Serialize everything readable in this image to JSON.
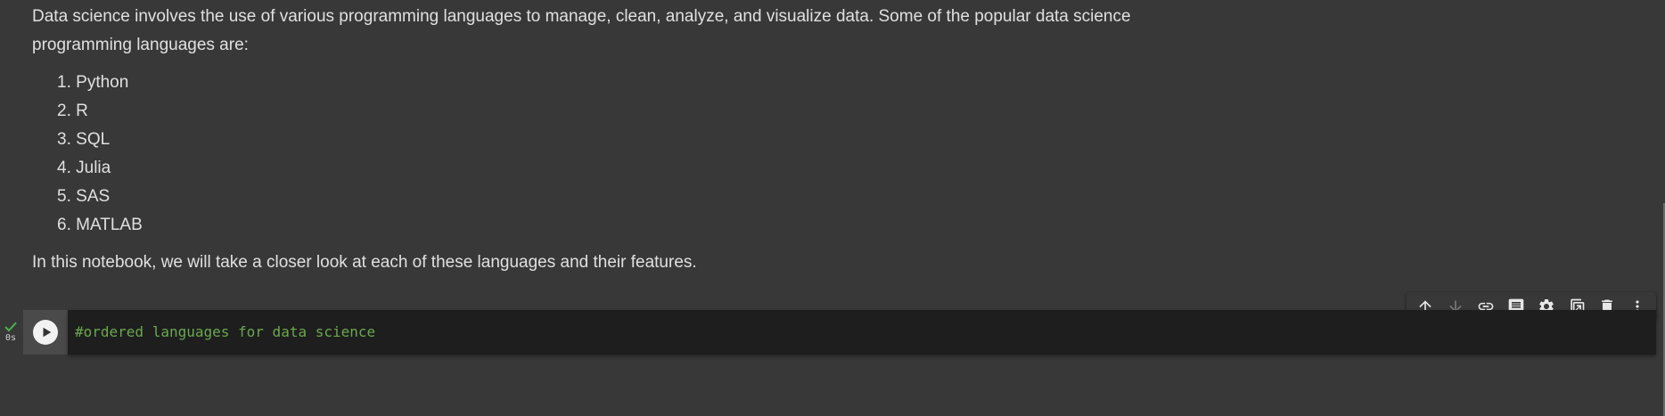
{
  "text_cell": {
    "intro": "Data science involves the use of various programming languages to manage, clean, analyze, and visualize data. Some of the popular data science programming languages are:",
    "languages": [
      {
        "num": "1.",
        "name": "Python"
      },
      {
        "num": "2.",
        "name": "R"
      },
      {
        "num": "3.",
        "name": "SQL"
      },
      {
        "num": "4.",
        "name": "Julia"
      },
      {
        "num": "5.",
        "name": "SAS"
      },
      {
        "num": "6.",
        "name": "MATLAB"
      }
    ],
    "outro": "In this notebook, we will take a closer look at each of these languages and their features."
  },
  "toolbar": {
    "buttons": [
      {
        "icon": "arrow-up-icon",
        "enabled": true
      },
      {
        "icon": "arrow-down-icon",
        "enabled": false
      },
      {
        "icon": "link-icon",
        "enabled": true
      },
      {
        "icon": "comment-icon",
        "enabled": true
      },
      {
        "icon": "gear-icon",
        "enabled": true
      },
      {
        "icon": "mirror-cell-icon",
        "enabled": true
      },
      {
        "icon": "trash-icon",
        "enabled": true
      },
      {
        "icon": "more-vert-icon",
        "enabled": true
      }
    ]
  },
  "code_cell": {
    "status_time": "0s",
    "code": "#ordered languages for data science"
  },
  "colors": {
    "background": "#383838",
    "editor_background": "#1e1e1e",
    "comment": "#6aa84f",
    "check": "#4caf50",
    "text": "#e0e0e0"
  }
}
